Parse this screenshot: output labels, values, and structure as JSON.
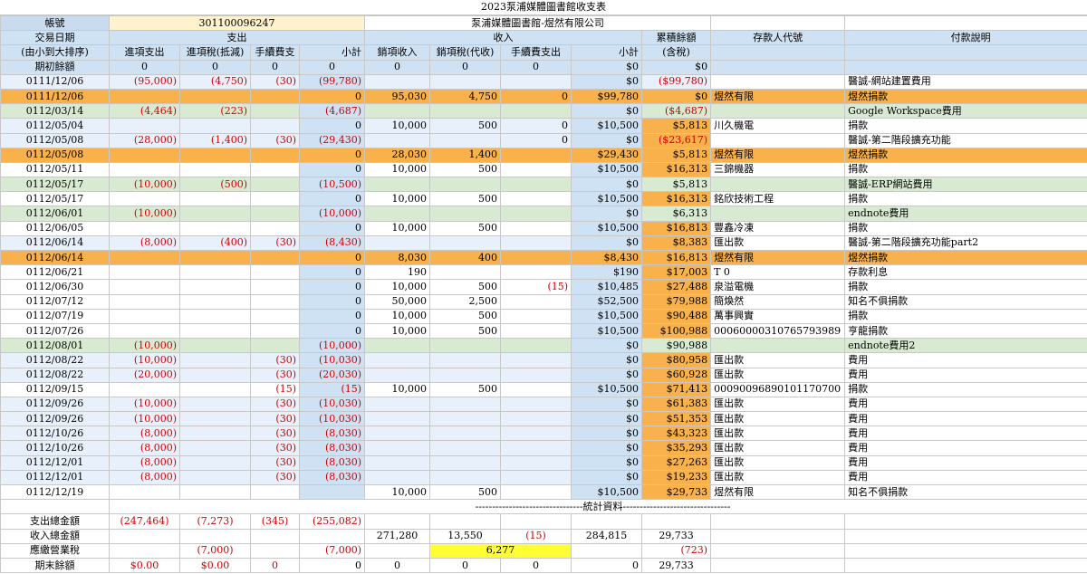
{
  "title": "2023泵浦媒體圖書館收支表",
  "account": {
    "label": "帳號",
    "number": "301100096247",
    "name": "泵浦媒體圖書館-煜然有限公司"
  },
  "headers": {
    "date": "交易日期",
    "expense": "支出",
    "income": "收入",
    "balance": "累積餘額",
    "depositor": "存款人代號",
    "note": "付款說明",
    "sort_note": "(由小到大排序)",
    "col_exp_pay": "進項支出",
    "col_exp_tax": "進項稅(抵減)",
    "col_exp_fee": "手續費支",
    "col_exp_sub": "小計",
    "col_inc_rev": "銷項收入",
    "col_inc_tax": "銷項稅(代收)",
    "col_inc_fee": "手續費支出",
    "col_inc_sub": "小計",
    "balance_sub": "(含稅)"
  },
  "opening": {
    "label": "期初餘額",
    "values": [
      "0",
      "0",
      "0",
      "0",
      "0",
      "0",
      "0",
      "$0",
      "$0"
    ]
  },
  "rows": [
    {
      "s": "light",
      "date": "0111/12/06",
      "ep": "(95,000)",
      "et": "(4,750)",
      "ef": "(30)",
      "es": "(99,780)",
      "ir": "",
      "it": "",
      "if": "",
      "is": "$0",
      "bal": "($99,780)",
      "dep": "",
      "note": "醫誠-網站建置費用"
    },
    {
      "s": "orange",
      "date": "0111/12/06",
      "ep": "",
      "et": "",
      "ef": "",
      "es": "0",
      "ir": "95,030",
      "it": "4,750",
      "if": "0",
      "is": "$99,780",
      "bal": "$0",
      "dep": "煜然有限",
      "note": "煜然捐款"
    },
    {
      "s": "green",
      "date": "0112/03/14",
      "ep": "(4,464)",
      "et": "(223)",
      "ef": "",
      "es": "(4,687)",
      "ir": "",
      "it": "",
      "if": "",
      "is": "$0",
      "bal": "($4,687)",
      "dep": "",
      "note": "Google Workspace費用"
    },
    {
      "s": "light",
      "date": "0112/05/04",
      "ep": "",
      "et": "",
      "ef": "",
      "es": "0",
      "ir": "10,000",
      "it": "500",
      "if": "0",
      "is": "$10,500",
      "bal": "$5,813",
      "dep": "川久機電",
      "note": "捐款"
    },
    {
      "s": "light",
      "date": "0112/05/08",
      "ep": "(28,000)",
      "et": "(1,400)",
      "ef": "(30)",
      "es": "(29,430)",
      "ir": "",
      "it": "",
      "if": "0",
      "is": "$0",
      "bal": "($23,617)",
      "dep": "",
      "note": "醫誠-第二階段擴充功能"
    },
    {
      "s": "orange",
      "date": "0112/05/08",
      "ep": "",
      "et": "",
      "ef": "",
      "es": "0",
      "ir": "28,030",
      "it": "1,400",
      "if": "",
      "is": "$29,430",
      "bal": "$5,813",
      "dep": "煜然有限",
      "note": "煜然捐款"
    },
    {
      "s": "white",
      "date": "0112/05/11",
      "ep": "",
      "et": "",
      "ef": "",
      "es": "0",
      "ir": "10,000",
      "it": "500",
      "if": "",
      "is": "$10,500",
      "bal": "$16,313",
      "dep": "三錦機器",
      "note": "捐款"
    },
    {
      "s": "green",
      "date": "0112/05/17",
      "ep": "(10,000)",
      "et": "(500)",
      "ef": "",
      "es": "(10,500)",
      "ir": "",
      "it": "",
      "if": "",
      "is": "$0",
      "bal": "$5,813",
      "dep": "",
      "note": "醫誠-ERP網站費用"
    },
    {
      "s": "white",
      "date": "0112/05/17",
      "ep": "",
      "et": "",
      "ef": "",
      "es": "0",
      "ir": "10,000",
      "it": "500",
      "if": "",
      "is": "$10,500",
      "bal": "$16,313",
      "dep": "銘欣技術工程",
      "note": "捐款"
    },
    {
      "s": "green",
      "date": "0112/06/01",
      "ep": "(10,000)",
      "et": "",
      "ef": "",
      "es": "(10,000)",
      "ir": "",
      "it": "",
      "if": "",
      "is": "$0",
      "bal": "$6,313",
      "dep": "",
      "note": "endnote費用"
    },
    {
      "s": "white",
      "date": "0112/06/05",
      "ep": "",
      "et": "",
      "ef": "",
      "es": "0",
      "ir": "10,000",
      "it": "500",
      "if": "",
      "is": "$10,500",
      "bal": "$16,813",
      "dep": "豐鑫冷凍",
      "note": "捐款"
    },
    {
      "s": "light",
      "date": "0112/06/14",
      "ep": "(8,000)",
      "et": "(400)",
      "ef": "(30)",
      "es": "(8,430)",
      "ir": "",
      "it": "",
      "if": "",
      "is": "$0",
      "bal": "$8,383",
      "dep": "匯出款",
      "note": "醫誠-第二階段擴充功能part2"
    },
    {
      "s": "orange",
      "date": "0112/06/14",
      "ep": "",
      "et": "",
      "ef": "",
      "es": "0",
      "ir": "8,030",
      "it": "400",
      "if": "",
      "is": "$8,430",
      "bal": "$16,813",
      "dep": "煜然有限",
      "note": "煜然捐款"
    },
    {
      "s": "white",
      "date": "0112/06/21",
      "ep": "",
      "et": "",
      "ef": "",
      "es": "0",
      "ir": "190",
      "it": "",
      "if": "",
      "is": "$190",
      "bal": "$17,003",
      "dep": "T 0",
      "note": "存款利息"
    },
    {
      "s": "white",
      "date": "0112/06/30",
      "ep": "",
      "et": "",
      "ef": "",
      "es": "0",
      "ir": "10,000",
      "it": "500",
      "if": "(15)",
      "is": "$10,485",
      "bal": "$27,488",
      "dep": "泉溢電機",
      "note": "捐款"
    },
    {
      "s": "white",
      "date": "0112/07/12",
      "ep": "",
      "et": "",
      "ef": "",
      "es": "0",
      "ir": "50,000",
      "it": "2,500",
      "if": "",
      "is": "$52,500",
      "bal": "$79,988",
      "dep": "簡煥然",
      "note": "知名不俱捐款"
    },
    {
      "s": "white",
      "date": "0112/07/19",
      "ep": "",
      "et": "",
      "ef": "",
      "es": "0",
      "ir": "10,000",
      "it": "500",
      "if": "",
      "is": "$10,500",
      "bal": "$90,488",
      "dep": "萬事興實",
      "note": "捐款"
    },
    {
      "s": "white",
      "date": "0112/07/26",
      "ep": "",
      "et": "",
      "ef": "",
      "es": "0",
      "ir": "10,000",
      "it": "500",
      "if": "",
      "is": "$10,500",
      "bal": "$100,988",
      "dep": "00060000310765793989",
      "note": "亨龍捐款"
    },
    {
      "s": "green",
      "date": "0112/08/01",
      "ep": "(10,000)",
      "et": "",
      "ef": "",
      "es": "(10,000)",
      "ir": "",
      "it": "",
      "if": "",
      "is": "$0",
      "bal": "$90,988",
      "dep": "",
      "note": "endnote費用2"
    },
    {
      "s": "light",
      "date": "0112/08/22",
      "ep": "(10,000)",
      "et": "",
      "ef": "(30)",
      "es": "(10,030)",
      "ir": "",
      "it": "",
      "if": "",
      "is": "$0",
      "bal": "$80,958",
      "dep": "匯出款",
      "note": "費用"
    },
    {
      "s": "light",
      "date": "0112/08/22",
      "ep": "(20,000)",
      "et": "",
      "ef": "(30)",
      "es": "(20,030)",
      "ir": "",
      "it": "",
      "if": "",
      "is": "$0",
      "bal": "$60,928",
      "dep": "匯出款",
      "note": "費用"
    },
    {
      "s": "white",
      "date": "0112/09/15",
      "ep": "",
      "et": "",
      "ef": "(15)",
      "es": "(15)",
      "ir": "10,000",
      "it": "500",
      "if": "",
      "is": "$10,500",
      "bal": "$71,413",
      "dep": "00090096890101170700",
      "note": "捐款"
    },
    {
      "s": "light",
      "date": "0112/09/26",
      "ep": "(10,000)",
      "et": "",
      "ef": "(30)",
      "es": "(10,030)",
      "ir": "",
      "it": "",
      "if": "",
      "is": "$0",
      "bal": "$61,383",
      "dep": "匯出款",
      "note": "費用"
    },
    {
      "s": "light",
      "date": "0112/09/26",
      "ep": "(10,000)",
      "et": "",
      "ef": "(30)",
      "es": "(10,030)",
      "ir": "",
      "it": "",
      "if": "",
      "is": "$0",
      "bal": "$51,353",
      "dep": "匯出款",
      "note": "費用"
    },
    {
      "s": "light",
      "date": "0112/10/26",
      "ep": "(8,000)",
      "et": "",
      "ef": "(30)",
      "es": "(8,030)",
      "ir": "",
      "it": "",
      "if": "",
      "is": "$0",
      "bal": "$43,323",
      "dep": "匯出款",
      "note": "費用"
    },
    {
      "s": "light",
      "date": "0112/10/26",
      "ep": "(8,000)",
      "et": "",
      "ef": "(30)",
      "es": "(8,030)",
      "ir": "",
      "it": "",
      "if": "",
      "is": "$0",
      "bal": "$35,293",
      "dep": "匯出款",
      "note": "費用"
    },
    {
      "s": "light",
      "date": "0112/12/01",
      "ep": "(8,000)",
      "et": "",
      "ef": "(30)",
      "es": "(8,030)",
      "ir": "",
      "it": "",
      "if": "",
      "is": "$0",
      "bal": "$27,263",
      "dep": "匯出款",
      "note": "費用"
    },
    {
      "s": "light",
      "date": "0112/12/01",
      "ep": "(8,000)",
      "et": "",
      "ef": "(30)",
      "es": "(8,030)",
      "ir": "",
      "it": "",
      "if": "",
      "is": "$0",
      "bal": "$19,233",
      "dep": "匯出款",
      "note": "費用"
    },
    {
      "s": "white",
      "date": "0112/12/19",
      "ep": "",
      "et": "",
      "ef": "",
      "es": "",
      "ir": "10,000",
      "it": "500",
      "if": "",
      "is": "$10,500",
      "bal": "$29,733",
      "dep": "煜然有限",
      "note": "知名不俱捐款"
    }
  ],
  "stats_label": "--------------------------------統計資料--------------------------------",
  "summary": {
    "exp_total": {
      "label": "支出總金額",
      "ep": "(247,464)",
      "et": "(7,273)",
      "ef": "(345)",
      "es": "(255,082)"
    },
    "inc_total": {
      "label": "收入總金額",
      "ir": "271,280",
      "it": "13,550",
      "if": "(15)",
      "is": "284,815",
      "bal": "29,733"
    },
    "tax": {
      "label": "應繳營業稅",
      "et": "(7,000)",
      "es": "(7,000)",
      "it": "6,277",
      "bal": "(723)"
    },
    "closing": {
      "label": "期末餘額",
      "values": [
        "$0.00",
        "$0.00",
        "0",
        "0",
        "0",
        "0",
        "0",
        "0",
        "29,733"
      ]
    }
  }
}
